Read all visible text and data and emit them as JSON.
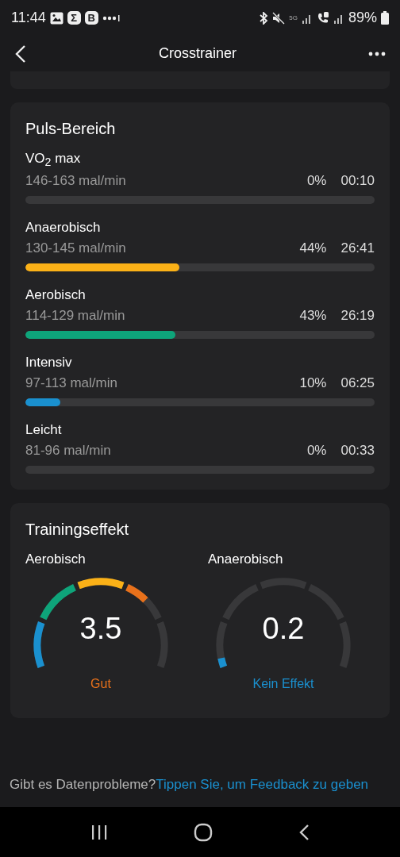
{
  "status_bar": {
    "time": "11:44",
    "badges": [
      "Σ",
      "B"
    ],
    "network": "5G",
    "battery": "89%"
  },
  "header": {
    "title": "Crosstrainer"
  },
  "heart_rate_zones": {
    "title": "Puls-Bereich",
    "zones": [
      {
        "name": "VO$_{2}$ max",
        "range": "146-163 mal/min",
        "percent": "0%",
        "time": "00:10"
      },
      {
        "name": "Anaerobisch",
        "range": "130-145 mal/min",
        "percent": "44%",
        "time": "26:41",
        "level": 0.44,
        "color": "#fbb117"
      },
      {
        "name": "Aerobisch",
        "range": "114-129 mal/min",
        "percent": "43%",
        "time": "26:19",
        "level": 0.43,
        "color": "#0ea47a"
      },
      {
        "name": "Intensiv",
        "range": "97-113 mal/min",
        "percent": "10%",
        "time": "06:25",
        "level": 0.1,
        "color": "#1a90cf"
      },
      {
        "name": "Leicht",
        "range": "81-96 mal/min",
        "percent": "0%",
        "time": "00:33"
      }
    ]
  },
  "training_effect": {
    "title": "Trainingseffekt",
    "gauges": [
      {
        "label": "Aerobisch",
        "value": "3.5",
        "rating": "Gut",
        "color": "#e8711b"
      },
      {
        "label": "Anaerobisch",
        "value": "0.2",
        "rating": "Kein Effekt",
        "color": "#1a90cf"
      }
    ]
  },
  "footer": {
    "question": "Gibt es Datenprobleme?",
    "link": "Tippen Sie, um Feedback zu geben"
  }
}
